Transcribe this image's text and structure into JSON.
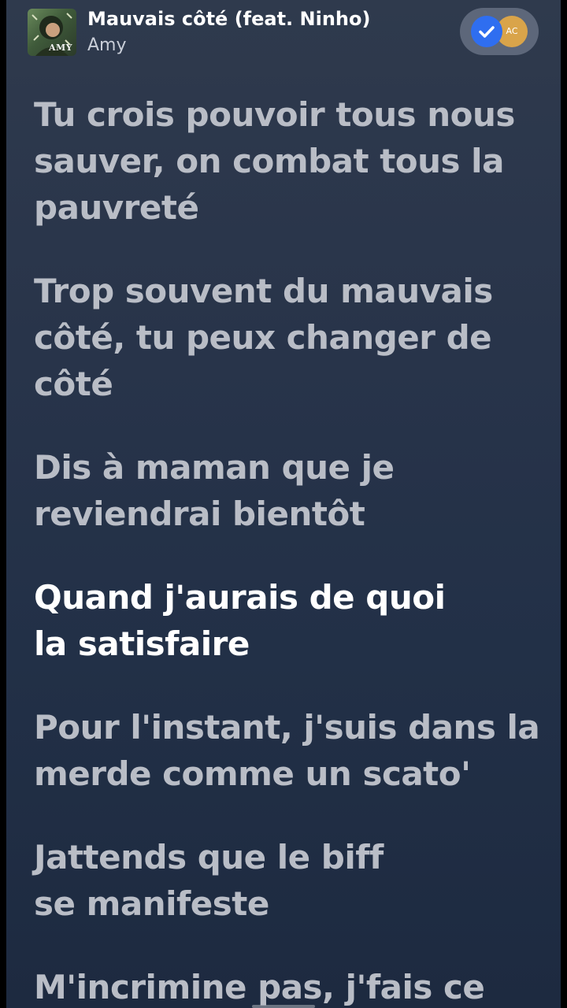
{
  "now_playing": {
    "title": "Mauvais côté (feat. Ninho)",
    "artist": "Amy",
    "album_art_text": "AMY",
    "icon": "album-art"
  },
  "share": {
    "avatar_initials": "AC",
    "check_icon": "check-icon",
    "colors": {
      "check": "#2f6ef0",
      "avatar": "#d9a44a"
    }
  },
  "lyrics": {
    "active_index": 3,
    "lines": [
      [
        "Tu crois pouvoir tous nous",
        "sauver, on combat tous la",
        "pauvreté"
      ],
      [
        "Trop souvent du mauvais",
        "côté, tu peux changer de",
        "côté"
      ],
      [
        "Dis à maman que je",
        "reviendrai bientôt"
      ],
      [
        "Quand j'aurais de quoi",
        "la satisfaire"
      ],
      [
        "Pour l'instant, j'suis dans la",
        "merde comme un scato'"
      ],
      [
        "Jattends que le biff",
        "se manifeste"
      ],
      [
        "M'incrimine pas, j'fais ce"
      ]
    ]
  },
  "colors": {
    "background": "#28344a",
    "lyric_inactive": "#b9bdc6",
    "lyric_active": "#ffffff"
  }
}
